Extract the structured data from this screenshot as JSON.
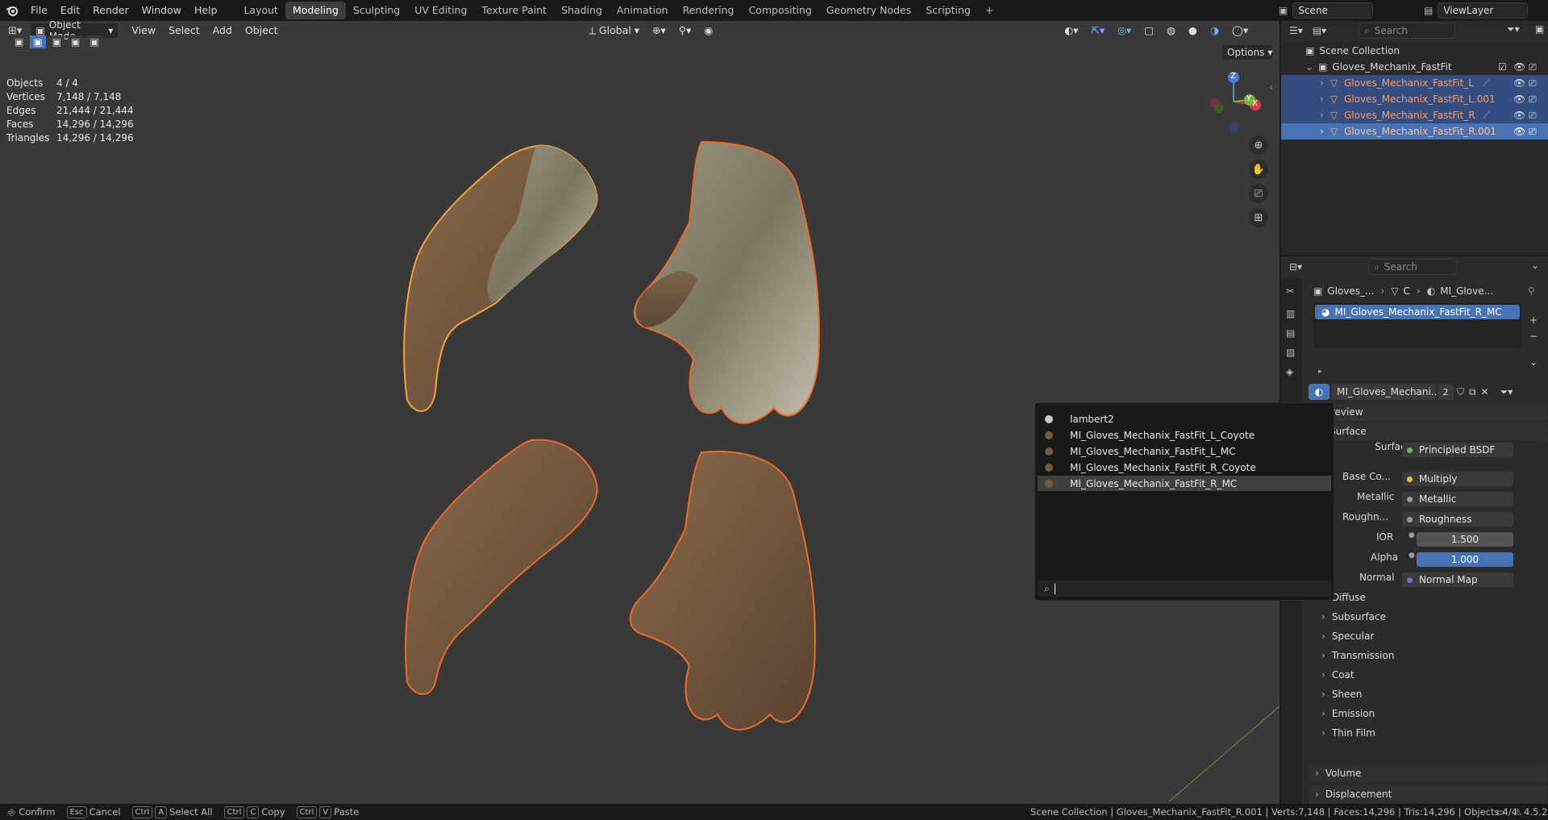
{
  "menubar": {
    "file": "File",
    "edit": "Edit",
    "render": "Render",
    "window": "Window",
    "help": "Help"
  },
  "workspaces": [
    "Layout",
    "Modeling",
    "Sculpting",
    "UV Editing",
    "Texture Paint",
    "Shading",
    "Animation",
    "Rendering",
    "Compositing",
    "Geometry Nodes",
    "Scripting"
  ],
  "active_workspace": "Modeling",
  "scene": "Scene",
  "view_layer": "ViewLayer",
  "viewport": {
    "mode": "Object Mode",
    "view": "View",
    "select": "Select",
    "add": "Add",
    "object": "Object",
    "orientation": "Global",
    "options": "Options",
    "stats": {
      "objects_label": "Objects",
      "objects": "4 / 4",
      "vertices_label": "Vertices",
      "vertices": "7,148 / 7,148",
      "edges_label": "Edges",
      "edges": "21,444 / 21,444",
      "faces_label": "Faces",
      "faces": "14,296 / 14,296",
      "triangles_label": "Triangles",
      "triangles": "14,296 / 14,296"
    },
    "gizmo": {
      "z": "Z",
      "y": "Y",
      "x": "X"
    }
  },
  "outliner": {
    "search_placeholder": "Search",
    "scene_collection": "Scene Collection",
    "collection": "Gloves_Mechanix_FastFit",
    "items": [
      "Gloves_Mechanix_FastFit_L",
      "Gloves_Mechanix_FastFit_L.001",
      "Gloves_Mechanix_FastFit_R",
      "Gloves_Mechanix_FastFit_R.001"
    ]
  },
  "properties": {
    "search_placeholder": "Search",
    "breadcrumb": {
      "object": "Gloves_...",
      "mesh": "C",
      "material": "MI_Glove..."
    },
    "slot": "MI_Gloves_Mechanix_FastFit_R_MC",
    "material_name": "MI_Gloves_Mechani...",
    "users": "2",
    "preview": "Preview",
    "surface_section": "Surface",
    "surface_label": "Surface",
    "surface_value": "Principled BSDF",
    "rows": [
      {
        "label": "Base Co...",
        "value": "Multiply"
      },
      {
        "label": "Metallic",
        "value": "Metallic"
      },
      {
        "label": "Roughn...",
        "value": "Roughness"
      },
      {
        "label": "IOR",
        "value": "1.500"
      },
      {
        "label": "Alpha",
        "value": "1.000"
      },
      {
        "label": "Normal",
        "value": "Normal Map"
      }
    ],
    "subsections": [
      "Diffuse",
      "Subsurface",
      "Specular",
      "Transmission",
      "Coat",
      "Sheen",
      "Emission",
      "Thin Film"
    ],
    "volume": "Volume",
    "displacement": "Displacement",
    "colors": {
      "selection": "#4772b3",
      "orange": "#ff9a5c"
    }
  },
  "material_popup": {
    "items": [
      "lambert2",
      "MI_Gloves_Mechanix_FastFit_L_Coyote",
      "MI_Gloves_Mechanix_FastFit_L_MC",
      "MI_Gloves_Mechanix_FastFit_R_Coyote",
      "MI_Gloves_Mechanix_FastFit_R_MC"
    ],
    "highlighted": "MI_Gloves_Mechanix_FastFit_R_MC"
  },
  "statusbar": {
    "confirm": "Confirm",
    "cancel": "Cancel",
    "esc": "Esc",
    "ctrl": "Ctrl",
    "a": "A",
    "select_all": "Select All",
    "c": "C",
    "copy": "Copy",
    "v": "V",
    "paste": "Paste",
    "info": "Scene Collection | Gloves_Mechanix_FastFit_R.001 | Verts:7,148 | Faces:14,296 | Tris:14,296 | Objects:4/4",
    "version": "4.5.2"
  }
}
